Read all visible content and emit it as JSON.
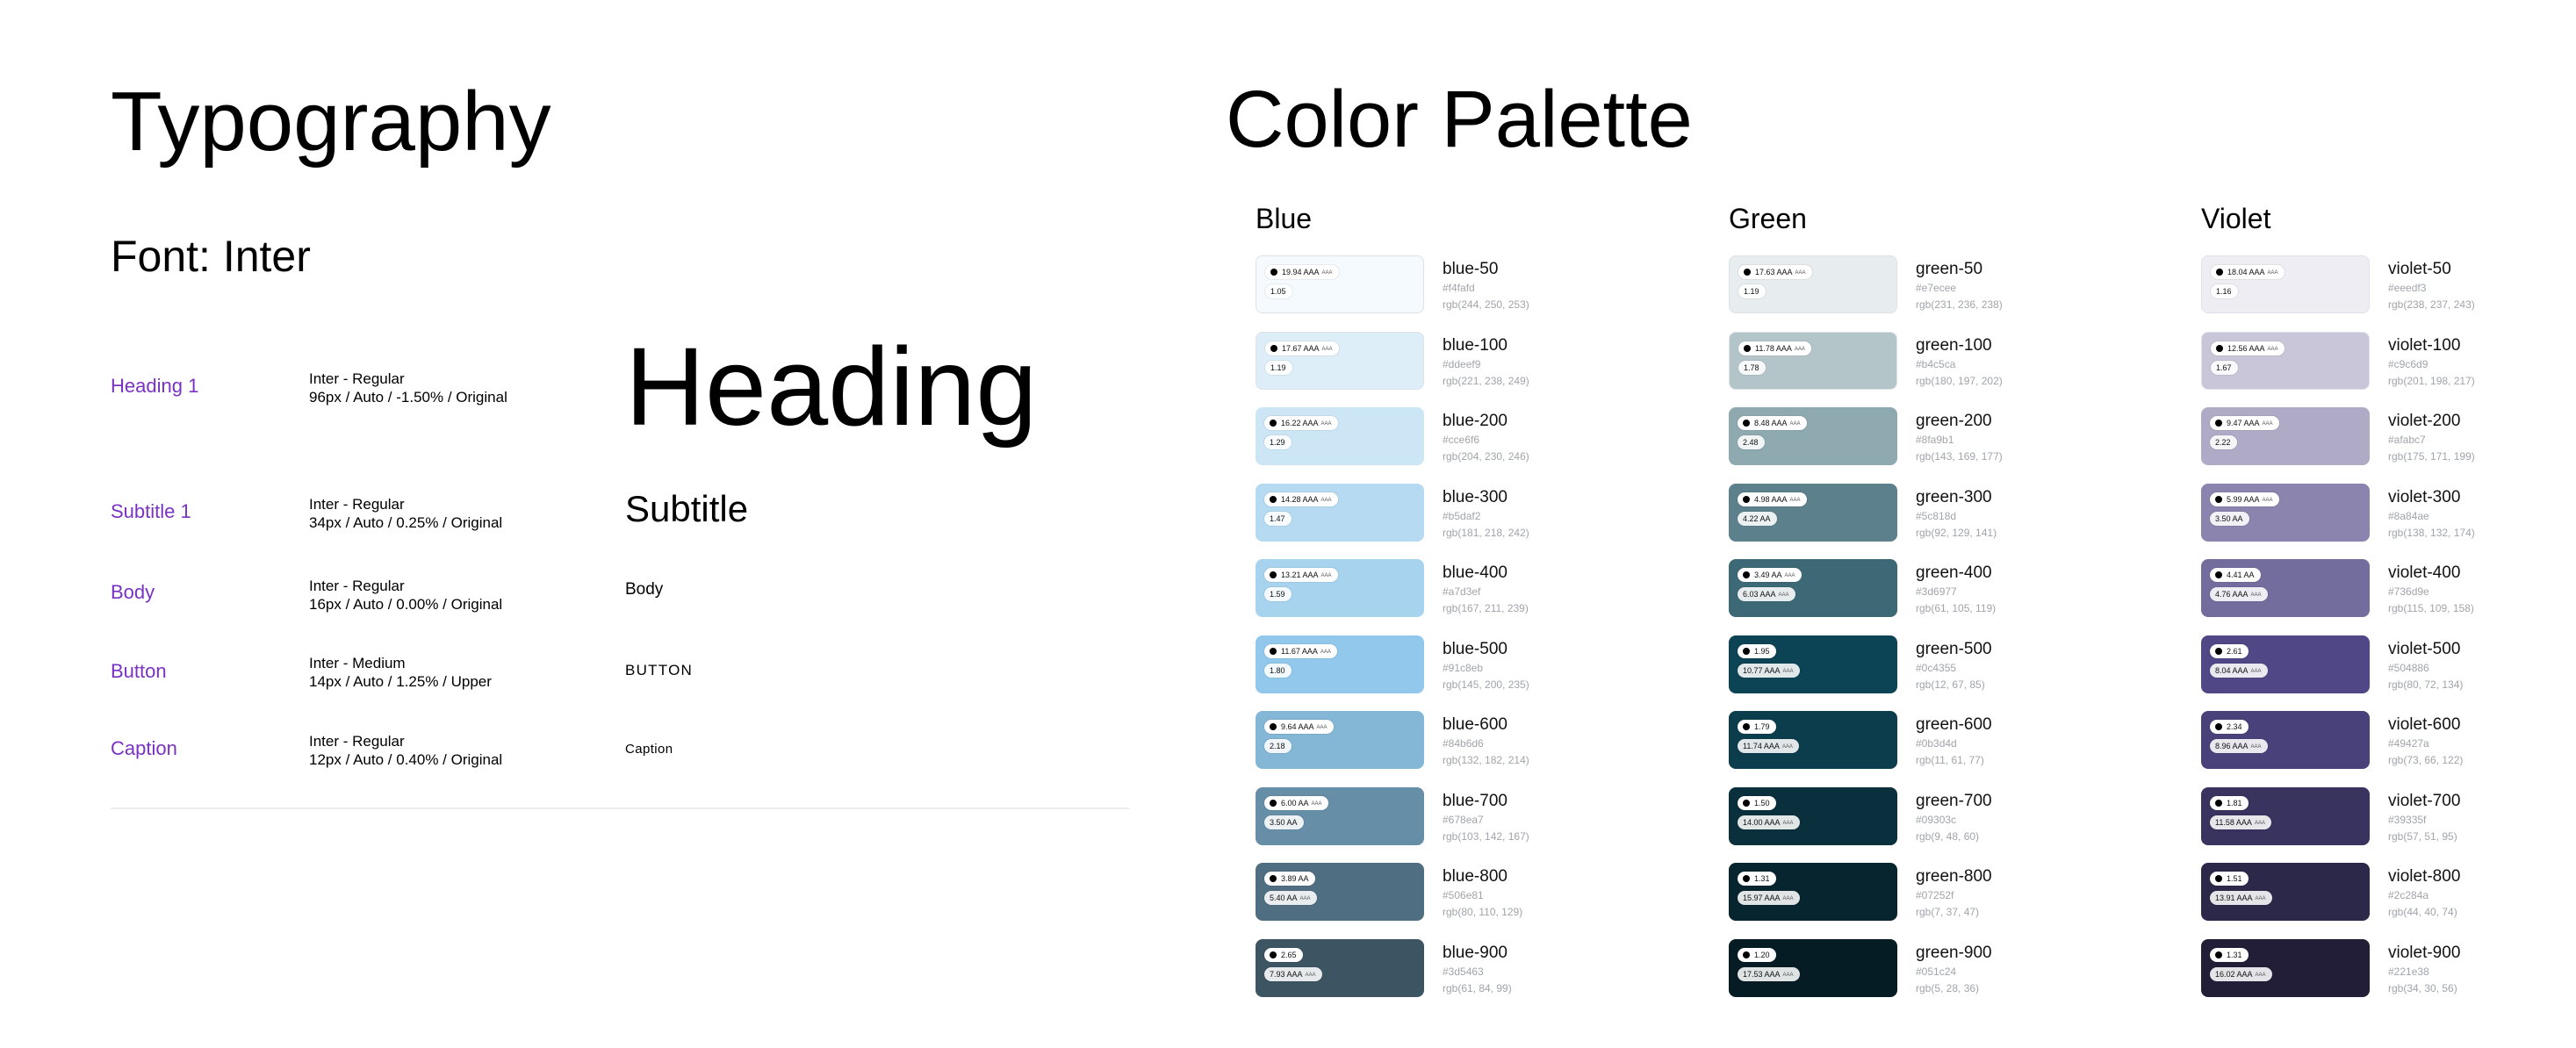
{
  "typography": {
    "title": "Typography",
    "font_label": "Font: Inter",
    "specs": [
      {
        "name": "Heading 1",
        "line1": "Inter - Regular",
        "line2": "96px / Auto / -1.50% / Original",
        "sample": "Heading"
      },
      {
        "name": "Subtitle 1",
        "line1": "Inter - Regular",
        "line2": "34px / Auto / 0.25% / Original",
        "sample": "Subtitle"
      },
      {
        "name": "Body",
        "line1": "Inter - Regular",
        "line2": "16px / Auto / 0.00% / Original",
        "sample": "Body"
      },
      {
        "name": "Button",
        "line1": "Inter - Medium",
        "line2": "14px / Auto / 1.25% / Upper",
        "sample": "BUTTON"
      },
      {
        "name": "Caption",
        "line1": "Inter - Regular",
        "line2": "12px / Auto / 0.40% / Original",
        "sample": "Caption"
      }
    ]
  },
  "palette": {
    "title": "Color Palette",
    "groups": [
      {
        "name": "Blue",
        "swatches": [
          {
            "name": "blue-50",
            "hex": "#f4fafd",
            "rgb": "rgb(244, 250, 253)",
            "c1": "19.94 AAA",
            "c1_aaa": true,
            "c2": "1.05",
            "c2_aaa": false
          },
          {
            "name": "blue-100",
            "hex": "#ddeef9",
            "rgb": "rgb(221, 238, 249)",
            "c1": "17.67 AAA",
            "c1_aaa": true,
            "c2": "1.19",
            "c2_aaa": false
          },
          {
            "name": "blue-200",
            "hex": "#cce6f6",
            "rgb": "rgb(204, 230, 246)",
            "c1": "16.22 AAA",
            "c1_aaa": true,
            "c2": "1.29",
            "c2_aaa": false
          },
          {
            "name": "blue-300",
            "hex": "#b5daf2",
            "rgb": "rgb(181, 218, 242)",
            "c1": "14.28 AAA",
            "c1_aaa": true,
            "c2": "1.47",
            "c2_aaa": false
          },
          {
            "name": "blue-400",
            "hex": "#a7d3ef",
            "rgb": "rgb(167, 211, 239)",
            "c1": "13.21 AAA",
            "c1_aaa": true,
            "c2": "1.59",
            "c2_aaa": false
          },
          {
            "name": "blue-500",
            "hex": "#91c8eb",
            "rgb": "rgb(145, 200, 235)",
            "c1": "11.67 AAA",
            "c1_aaa": true,
            "c2": "1.80",
            "c2_aaa": false
          },
          {
            "name": "blue-600",
            "hex": "#84b6d6",
            "rgb": "rgb(132, 182, 214)",
            "c1": "9.64 AAA",
            "c1_aaa": true,
            "c2": "2.18",
            "c2_aaa": false
          },
          {
            "name": "blue-700",
            "hex": "#678ea7",
            "rgb": "rgb(103, 142, 167)",
            "c1": "6.00 AA",
            "c1_aaa": true,
            "c2": "3.50 AA",
            "c2_aaa": false
          },
          {
            "name": "blue-800",
            "hex": "#506e81",
            "rgb": "rgb(80, 110, 129)",
            "c1": "3.89 AA",
            "c1_aaa": false,
            "c2": "5.40 AA",
            "c2_aaa": true
          },
          {
            "name": "blue-900",
            "hex": "#3d5463",
            "rgb": "rgb(61, 84, 99)",
            "c1": "2.65",
            "c1_aaa": false,
            "c2": "7.93 AAA",
            "c2_aaa": true
          }
        ]
      },
      {
        "name": "Green",
        "swatches": [
          {
            "name": "green-50",
            "hex": "#e7ecee",
            "rgb": "rgb(231, 236, 238)",
            "c1": "17.63 AAA",
            "c1_aaa": true,
            "c2": "1.19",
            "c2_aaa": false
          },
          {
            "name": "green-100",
            "hex": "#b4c5ca",
            "rgb": "rgb(180, 197, 202)",
            "c1": "11.78 AAA",
            "c1_aaa": true,
            "c2": "1.78",
            "c2_aaa": false
          },
          {
            "name": "green-200",
            "hex": "#8fa9b1",
            "rgb": "rgb(143, 169, 177)",
            "c1": "8.48 AAA",
            "c1_aaa": true,
            "c2": "2.48",
            "c2_aaa": false
          },
          {
            "name": "green-300",
            "hex": "#5c818d",
            "rgb": "rgb(92, 129, 141)",
            "c1": "4.98 AAA",
            "c1_aaa": true,
            "c2": "4.22 AA",
            "c2_aaa": false
          },
          {
            "name": "green-400",
            "hex": "#3d6977",
            "rgb": "rgb(61, 105, 119)",
            "c1": "3.49 AA",
            "c1_aaa": true,
            "c2": "6.03 AAA",
            "c2_aaa": true
          },
          {
            "name": "green-500",
            "hex": "#0c4355",
            "rgb": "rgb(12, 67, 85)",
            "c1": "1.95",
            "c1_aaa": false,
            "c2": "10.77 AAA",
            "c2_aaa": true
          },
          {
            "name": "green-600",
            "hex": "#0b3d4d",
            "rgb": "rgb(11, 61, 77)",
            "c1": "1.79",
            "c1_aaa": false,
            "c2": "11.74 AAA",
            "c2_aaa": true
          },
          {
            "name": "green-700",
            "hex": "#09303c",
            "rgb": "rgb(9, 48, 60)",
            "c1": "1.50",
            "c1_aaa": false,
            "c2": "14.00 AAA",
            "c2_aaa": true
          },
          {
            "name": "green-800",
            "hex": "#07252f",
            "rgb": "rgb(7, 37, 47)",
            "c1": "1.31",
            "c1_aaa": false,
            "c2": "15.97 AAA",
            "c2_aaa": true
          },
          {
            "name": "green-900",
            "hex": "#051c24",
            "rgb": "rgb(5, 28, 36)",
            "c1": "1.20",
            "c1_aaa": false,
            "c2": "17.53 AAA",
            "c2_aaa": true
          }
        ]
      },
      {
        "name": "Violet",
        "swatches": [
          {
            "name": "violet-50",
            "hex": "#eeedf3",
            "rgb": "rgb(238, 237, 243)",
            "c1": "18.04 AAA",
            "c1_aaa": true,
            "c2": "1.16",
            "c2_aaa": false
          },
          {
            "name": "violet-100",
            "hex": "#c9c6d9",
            "rgb": "rgb(201, 198, 217)",
            "c1": "12.56 AAA",
            "c1_aaa": true,
            "c2": "1.67",
            "c2_aaa": false
          },
          {
            "name": "violet-200",
            "hex": "#afabc7",
            "rgb": "rgb(175, 171, 199)",
            "c1": "9.47 AAA",
            "c1_aaa": true,
            "c2": "2.22",
            "c2_aaa": false
          },
          {
            "name": "violet-300",
            "hex": "#8a84ae",
            "rgb": "rgb(138, 132, 174)",
            "c1": "5.99 AAA",
            "c1_aaa": true,
            "c2": "3.50 AA",
            "c2_aaa": false
          },
          {
            "name": "violet-400",
            "hex": "#736d9e",
            "rgb": "rgb(115, 109, 158)",
            "c1": "4.41 AA",
            "c1_aaa": false,
            "c2": "4.76 AAA",
            "c2_aaa": true
          },
          {
            "name": "violet-500",
            "hex": "#504886",
            "rgb": "rgb(80, 72, 134)",
            "c1": "2.61",
            "c1_aaa": false,
            "c2": "8.04 AAA",
            "c2_aaa": true
          },
          {
            "name": "violet-600",
            "hex": "#49427a",
            "rgb": "rgb(73, 66, 122)",
            "c1": "2.34",
            "c1_aaa": false,
            "c2": "8.96 AAA",
            "c2_aaa": true
          },
          {
            "name": "violet-700",
            "hex": "#39335f",
            "rgb": "rgb(57, 51, 95)",
            "c1": "1.81",
            "c1_aaa": false,
            "c2": "11.58 AAA",
            "c2_aaa": true
          },
          {
            "name": "violet-800",
            "hex": "#2c284a",
            "rgb": "rgb(44, 40, 74)",
            "c1": "1.51",
            "c1_aaa": false,
            "c2": "13.91 AAA",
            "c2_aaa": true
          },
          {
            "name": "violet-900",
            "hex": "#221e38",
            "rgb": "rgb(34, 30, 56)",
            "c1": "1.31",
            "c1_aaa": false,
            "c2": "16.02 AAA",
            "c2_aaa": true
          }
        ]
      }
    ]
  }
}
